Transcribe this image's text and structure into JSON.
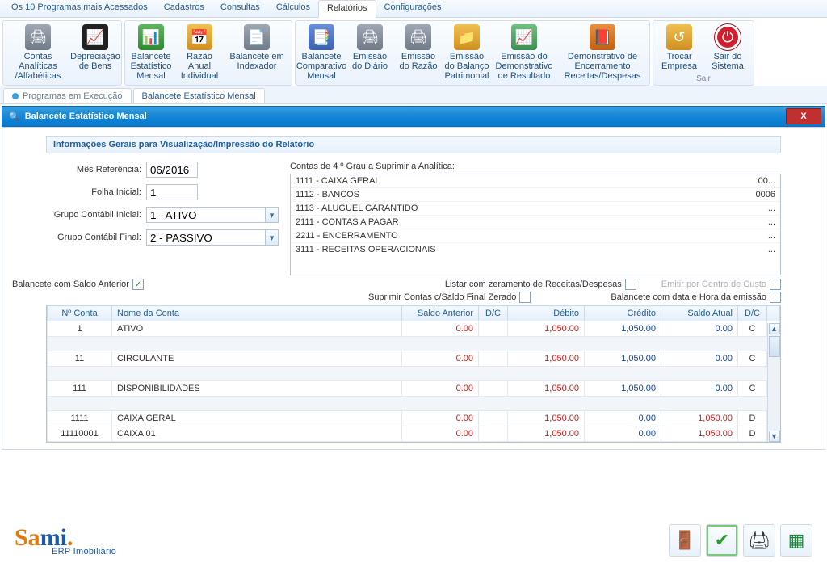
{
  "menu": {
    "items": [
      "Os 10 Programas mais Acessados",
      "Cadastros",
      "Consultas",
      "Cálculos",
      "Relatórios",
      "Configurações"
    ],
    "activeIndex": 4
  },
  "ribbon": {
    "groups": [
      {
        "buttons": [
          {
            "label": "Contas Analíticas /Alfabéticas"
          },
          {
            "label": "Depreciação de Bens"
          }
        ]
      },
      {
        "buttons": [
          {
            "label": "Balancete Estatístico Mensal"
          },
          {
            "label": "Razão Anual Individual"
          },
          {
            "label": "Balancete em Indexador"
          }
        ]
      },
      {
        "buttons": [
          {
            "label": "Balancete Comparativo Mensal"
          },
          {
            "label": "Emissão do Diário"
          },
          {
            "label": "Emissão do Razão"
          },
          {
            "label": "Emissão do Balanço Patrimonial"
          },
          {
            "label": "Emissão do Demonstrativo de Resultado"
          },
          {
            "label": "Demonstrativo de Encerramento Receitas/Despesas"
          }
        ]
      },
      {
        "caption": "Sair",
        "buttons": [
          {
            "label": "Trocar Empresa"
          },
          {
            "label": "Sair do Sistema"
          }
        ]
      }
    ]
  },
  "doctabs": {
    "items": [
      {
        "label": "Programas em Execução"
      },
      {
        "label": "Balancete Estatístico Mensal"
      }
    ],
    "activeIndex": 1
  },
  "window": {
    "title": "Balancete Estatístico Mensal"
  },
  "section_title": "Informações Gerais para Visualização/Impressão do Relatório",
  "form": {
    "mes_ref_label": "Mês Referência:",
    "mes_ref_value": "06/2016",
    "folha_label": "Folha Inicial:",
    "folha_value": "1",
    "grupo_ini_label": "Grupo Contábil Inicial:",
    "grupo_ini_value": "1 - ATIVO",
    "grupo_fin_label": "Grupo Contábil Final:",
    "grupo_fin_value": "2 - PASSIVO",
    "contas_title": "Contas de  4 º Grau  a Suprimir a Analítica:",
    "contas": [
      {
        "name": "1111 - CAIXA GERAL",
        "code": "00..."
      },
      {
        "name": "1112 - BANCOS",
        "code": "0006"
      },
      {
        "name": "1113 - ALUGUEL GARANTIDO",
        "code": "..."
      },
      {
        "name": "2111 - CONTAS A PAGAR",
        "code": "..."
      },
      {
        "name": "2211 - ENCERRAMENTO",
        "code": "..."
      },
      {
        "name": "3111 - RECEITAS OPERACIONAIS",
        "code": "..."
      }
    ]
  },
  "checks": {
    "saldo_anterior": {
      "label": "Balancete com Saldo Anterior",
      "checked": true
    },
    "listar_zeramento": {
      "label": "Listar com zeramento de Receitas/Despesas",
      "checked": false
    },
    "centro_custo": {
      "label": "Emitir por Centro de Custo",
      "checked": false,
      "disabled": true
    },
    "suprimir_zerado": {
      "label": "Suprimir Contas c/Saldo Final Zerado",
      "checked": false
    },
    "data_hora": {
      "label": "Balancete com data e Hora da emissão",
      "checked": false
    }
  },
  "grid": {
    "headers": [
      "Nº Conta",
      "Nome da Conta",
      "Saldo Anterior",
      "D/C",
      "Débito",
      "Crédito",
      "Saldo Atual",
      "D/C"
    ],
    "rows": [
      {
        "num": "1",
        "nome": "ATIVO",
        "sa": "0.00",
        "dc1": "",
        "deb": "1,050.00",
        "cred": "1,050.00",
        "satual": "0.00",
        "dc2": "C"
      },
      {
        "spacer": true
      },
      {
        "num": "11",
        "nome": "CIRCULANTE",
        "sa": "0.00",
        "dc1": "",
        "deb": "1,050.00",
        "cred": "1,050.00",
        "satual": "0.00",
        "dc2": "C"
      },
      {
        "spacer": true
      },
      {
        "num": "111",
        "nome": "DISPONIBILIDADES",
        "sa": "0.00",
        "dc1": "",
        "deb": "1,050.00",
        "cred": "1,050.00",
        "satual": "0.00",
        "dc2": "C"
      },
      {
        "spacer": true
      },
      {
        "num": "1111",
        "nome": "CAIXA GERAL",
        "sa": "0.00",
        "dc1": "",
        "deb": "1,050.00",
        "cred": "0.00",
        "satual": "1,050.00",
        "dc2": "D",
        "satual_red": true
      },
      {
        "num": "11110001",
        "nome": "CAIXA 01",
        "sa": "0.00",
        "dc1": "",
        "deb": "1,050.00",
        "cred": "0.00",
        "satual": "1,050.00",
        "dc2": "D",
        "satual_red": true
      }
    ]
  },
  "logo": {
    "part1": "Sa",
    "part2": "mi",
    "dot": ".",
    "sub": "ERP Imobiliário"
  }
}
